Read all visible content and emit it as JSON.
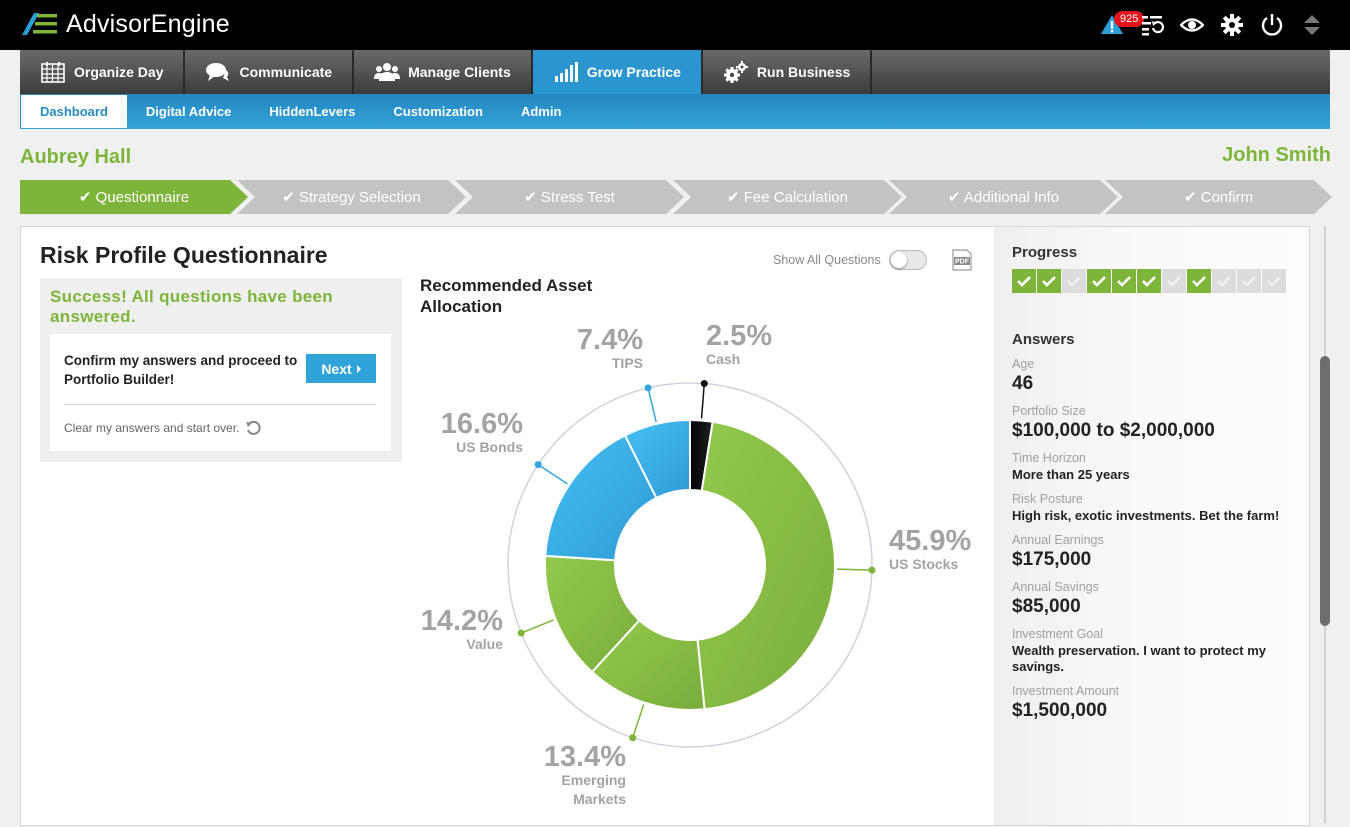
{
  "app": {
    "name": "AdvisorEngine",
    "notifications_count": "925"
  },
  "top_icons": [
    "alert-icon",
    "activity-log-icon",
    "eye-icon",
    "gear-icon",
    "power-icon",
    "sort-arrows-icon"
  ],
  "main_nav": [
    {
      "label": "Organize Day",
      "icon": "calendar-icon",
      "active": false
    },
    {
      "label": "Communicate",
      "icon": "chat-bubbles-icon",
      "active": false
    },
    {
      "label": "Manage Clients",
      "icon": "users-icon",
      "active": false
    },
    {
      "label": "Grow Practice",
      "icon": "bar-chart-icon",
      "active": true
    },
    {
      "label": "Run Business",
      "icon": "gears-icon",
      "active": false
    }
  ],
  "sub_nav": [
    {
      "label": "Dashboard",
      "active": true
    },
    {
      "label": "Digital Advice",
      "active": false
    },
    {
      "label": "HiddenLevers",
      "active": false
    },
    {
      "label": "Customization",
      "active": false
    },
    {
      "label": "Admin",
      "active": false
    }
  ],
  "client_name": "Aubrey Hall",
  "advisor_name": "John Smith",
  "steps": [
    {
      "label": "✔ Questionnaire",
      "active": true
    },
    {
      "label": "✔ Strategy Selection",
      "active": false
    },
    {
      "label": "✔ Stress Test",
      "active": false
    },
    {
      "label": "✔ Fee Calculation",
      "active": false
    },
    {
      "label": "✔ Additional Info",
      "active": false
    },
    {
      "label": "✔ Confirm",
      "active": false
    }
  ],
  "questionnaire": {
    "title": "Risk Profile Questionnaire",
    "success_message": "Success! All questions have been answered.",
    "confirm_text": "Confirm my answers and proceed to Portfolio Builder!",
    "next_label": "Next",
    "clear_text": "Clear my answers and start over.",
    "show_all_label": "Show All Questions",
    "show_all_enabled": false
  },
  "chart_data": {
    "type": "pie",
    "title": "Recommended Asset Allocation",
    "donut": true,
    "start": "top",
    "direction": "clockwise",
    "slices": [
      {
        "label": "Cash",
        "value": 2.5,
        "display": "2.5%",
        "color": "#111111"
      },
      {
        "label": "US Stocks",
        "value": 45.9,
        "display": "45.9%",
        "color": "#86bf45"
      },
      {
        "label": "Emerging Markets",
        "value": 13.4,
        "display": "13.4%",
        "color": "#82b841"
      },
      {
        "label": "Value",
        "value": 14.2,
        "display": "14.2%",
        "color": "#87be45"
      },
      {
        "label": "US Bonds",
        "value": 16.6,
        "display": "16.6%",
        "color": "#3aaee6"
      },
      {
        "label": "TIPS",
        "value": 7.4,
        "display": "7.4%",
        "color": "#3aaee6"
      }
    ]
  },
  "side": {
    "progress_title": "Progress",
    "progress": [
      true,
      true,
      false,
      true,
      true,
      true,
      false,
      true,
      false,
      false,
      false
    ],
    "answers_title": "Answers",
    "answers": [
      {
        "label": "Age",
        "value": "46",
        "size": "big"
      },
      {
        "label": "Portfolio Size",
        "value": "$100,000 to $2,000,000",
        "size": "big"
      },
      {
        "label": "Time Horizon",
        "value": "More than 25 years",
        "size": "small"
      },
      {
        "label": "Risk Posture",
        "value": "High risk, exotic investments. Bet the farm!",
        "size": "small"
      },
      {
        "label": "Annual Earnings",
        "value": "$175,000",
        "size": "big"
      },
      {
        "label": "Annual Savings",
        "value": "$85,000",
        "size": "big"
      },
      {
        "label": "Investment Goal",
        "value": "Wealth preservation. I want to protect my savings.",
        "size": "small"
      },
      {
        "label": "Investment Amount",
        "value": "$1,500,000",
        "size": "big"
      }
    ]
  },
  "colors": {
    "accent_green": "#7db53b",
    "accent_blue": "#2b95cf",
    "step_inactive": "#c3c3c3",
    "alert_red": "#e2141c"
  }
}
